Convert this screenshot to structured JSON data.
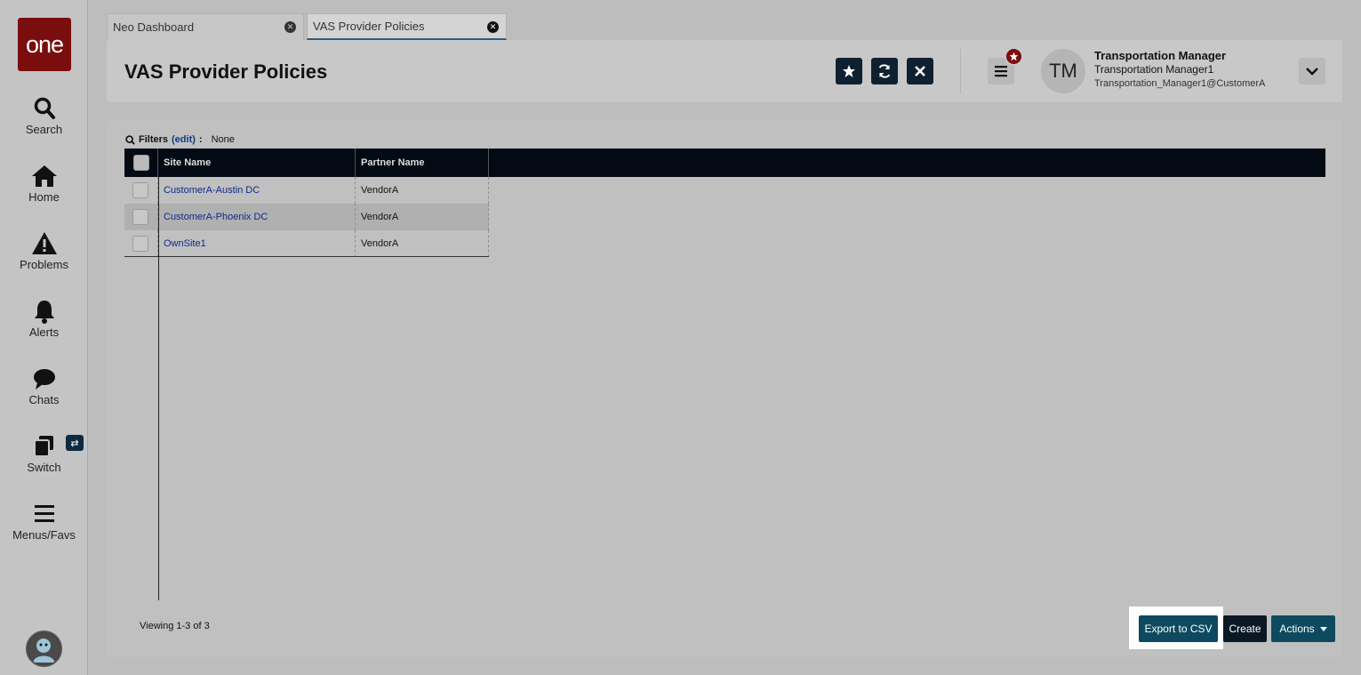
{
  "app": {
    "logo_text": "one"
  },
  "sidebar": {
    "items": [
      {
        "label": "Search",
        "icon": "search-icon"
      },
      {
        "label": "Home",
        "icon": "home-icon"
      },
      {
        "label": "Problems",
        "icon": "warning-icon"
      },
      {
        "label": "Alerts",
        "icon": "bell-icon"
      },
      {
        "label": "Chats",
        "icon": "chat-icon"
      },
      {
        "label": "Switch",
        "icon": "switch-icon"
      },
      {
        "label": "Menus/Favs",
        "icon": "hamburger-icon"
      }
    ],
    "switch_badge": "⇄"
  },
  "tabs": [
    {
      "label": "Neo Dashboard",
      "active": false
    },
    {
      "label": "VAS Provider Policies",
      "active": true
    }
  ],
  "header": {
    "title": "VAS Provider Policies",
    "user": {
      "initials": "TM",
      "name": "Transportation Manager",
      "role": "Transportation Manager1",
      "email": "Transportation_Manager1@CustomerA"
    }
  },
  "filters": {
    "label": "Filters",
    "edit_label": "(edit)",
    "value": "None"
  },
  "grid": {
    "columns": [
      "Site Name",
      "Partner Name"
    ],
    "rows": [
      {
        "site_name": "CustomerA-Austin DC",
        "partner_name": "VendorA"
      },
      {
        "site_name": "CustomerA-Phoenix DC",
        "partner_name": "VendorA"
      },
      {
        "site_name": "OwnSite1",
        "partner_name": "VendorA"
      }
    ]
  },
  "footer": {
    "viewing": "Viewing 1-3 of 3",
    "export_label": "Export to CSV",
    "create_label": "Create",
    "actions_label": "Actions"
  },
  "colors": {
    "brand": "#7a0d0d",
    "header_dark": "#030a13",
    "button_teal": "#0d4a60"
  }
}
